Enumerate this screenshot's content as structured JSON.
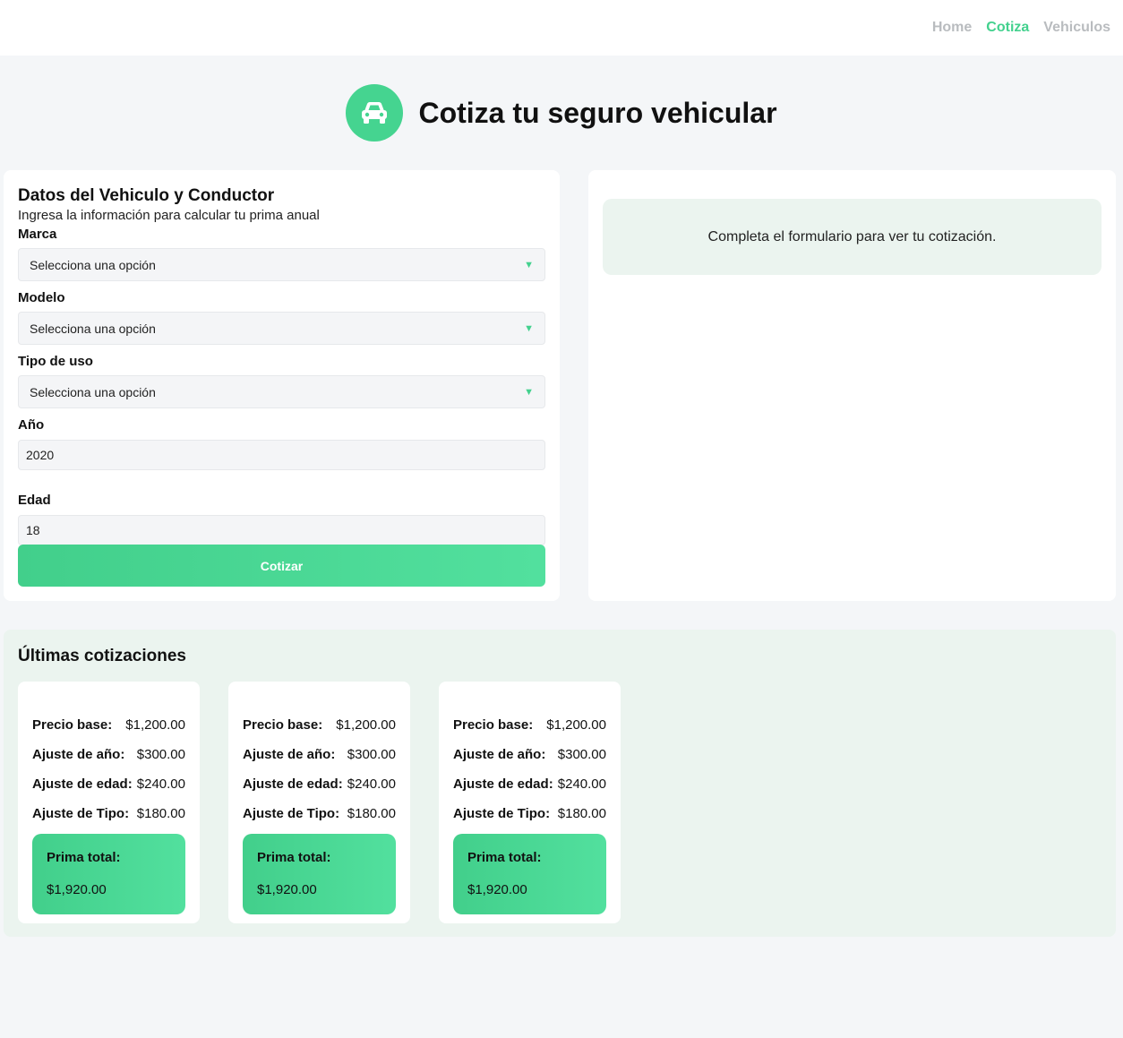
{
  "nav": {
    "links": [
      {
        "label": "Home",
        "active": false
      },
      {
        "label": "Cotiza",
        "active": true
      },
      {
        "label": "Vehiculos",
        "active": false
      }
    ]
  },
  "hero": {
    "icon": "car-icon",
    "title": "Cotiza tu seguro vehicular"
  },
  "form": {
    "title": "Datos del Vehiculo y Conductor",
    "subtitle": "Ingresa la información para calcular tu prima anual",
    "marca": {
      "label": "Marca",
      "value": "Selecciona una opción"
    },
    "modelo": {
      "label": "Modelo",
      "value": "Selecciona una opción"
    },
    "tipo": {
      "label": "Tipo de uso",
      "value": "Selecciona una opción"
    },
    "anio": {
      "label": "Año",
      "value": "2020"
    },
    "edad": {
      "label": "Edad",
      "value": "18"
    },
    "submit_label": "Cotizar"
  },
  "result": {
    "empty_message": "Completa el formulario para ver tu cotización."
  },
  "history": {
    "title": "Últimas cotizaciones",
    "labels": {
      "base": "Precio base:",
      "anio": "Ajuste de año:",
      "edad": "Ajuste de edad:",
      "tipo": "Ajuste de Tipo:",
      "total": "Prima total:"
    },
    "quotes": [
      {
        "base": "$1,200.00",
        "anio": "$300.00",
        "edad": "$240.00",
        "tipo": "$180.00",
        "total": "$1,920.00"
      },
      {
        "base": "$1,200.00",
        "anio": "$300.00",
        "edad": "$240.00",
        "tipo": "$180.00",
        "total": "$1,920.00"
      },
      {
        "base": "$1,200.00",
        "anio": "$300.00",
        "edad": "$240.00",
        "tipo": "$180.00",
        "total": "$1,920.00"
      }
    ]
  },
  "colors": {
    "accent": "#43d18e",
    "page_bg": "#f4f6f8",
    "history_bg": "#ebf4ef",
    "nav_inactive": "#b9bcbf"
  }
}
